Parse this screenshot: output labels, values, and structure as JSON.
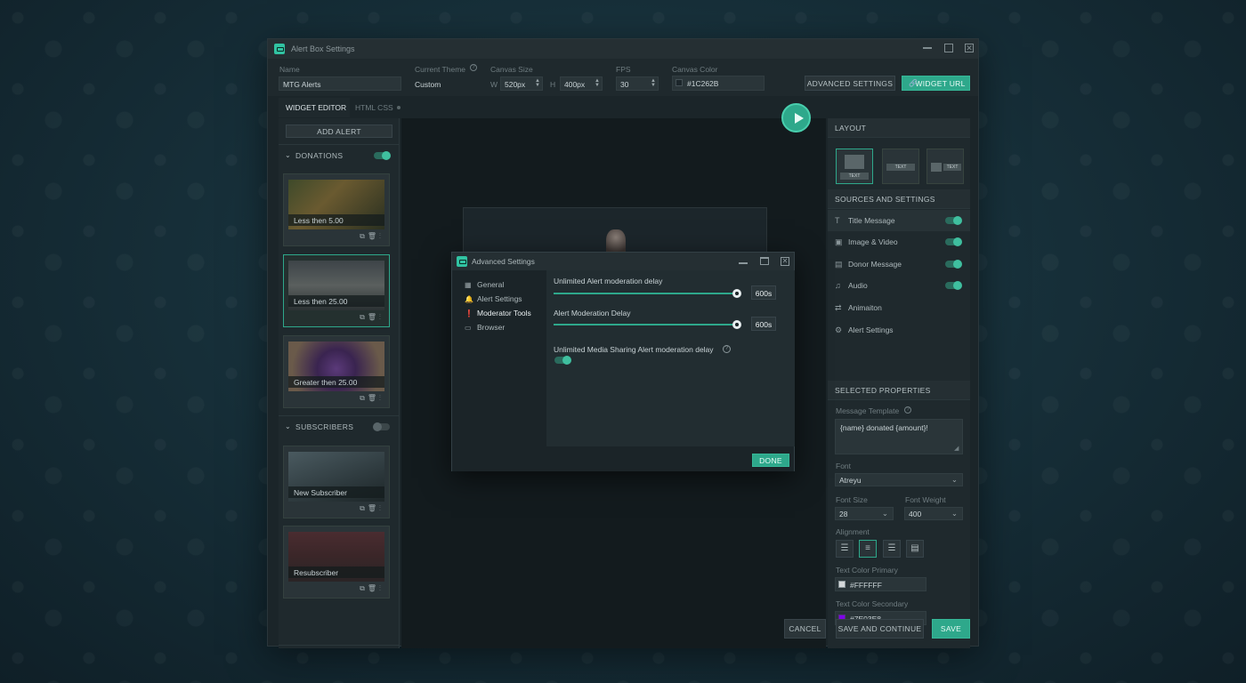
{
  "window": {
    "title": "Alert Box Settings"
  },
  "topbar": {
    "name_label": "Name",
    "name_value": "MTG Alerts",
    "theme_label": "Current Theme",
    "theme_value": "Custom",
    "canvas_size_label": "Canvas Size",
    "w_label": "W",
    "w_value": "520px",
    "h_label": "H",
    "h_value": "400px",
    "fps_label": "FPS",
    "fps_value": "30",
    "canvas_color_label": "Canvas Color",
    "canvas_color_value": "#1C262B",
    "advanced_settings_label": "ADVANCED SETTINGS",
    "widget_url_label": "WIDGET URL"
  },
  "tabs": [
    {
      "label": "WIDGET EDITOR"
    },
    {
      "label": "HTML CSS"
    }
  ],
  "left_panel": {
    "add_alert_label": "ADD ALERT",
    "donations_label": "DONATIONS",
    "donations_enabled": true,
    "donation_cards": [
      {
        "caption": "Less then 5.00"
      },
      {
        "caption": "Less then 25.00"
      },
      {
        "caption": "Greater then 25.00"
      }
    ],
    "subscribers_label": "SUBSCRIBERS",
    "subscribers_enabled": false,
    "subscriber_cards": [
      {
        "caption": "New Subscriber"
      },
      {
        "caption": "Resubscriber"
      }
    ]
  },
  "right_panel": {
    "layout_heading": "LAYOUT",
    "layout_options": [
      {
        "label": "TEXT"
      },
      {
        "label": "TEXT"
      },
      {
        "label": "TEXT"
      }
    ],
    "sources_heading": "SOURCES AND SETTINGS",
    "sources": [
      {
        "label": "Title Message",
        "enabled": true
      },
      {
        "label": "Image & Video",
        "enabled": true
      },
      {
        "label": "Donor Message",
        "enabled": true
      },
      {
        "label": "Audio",
        "enabled": true
      },
      {
        "label": "Animaiton"
      },
      {
        "label": "Alert Settings"
      }
    ],
    "selected_heading": "SELECTED PROPERTIES",
    "message_template_label": "Message Template",
    "message_template_value": "{name} donated {amount}!",
    "font_label": "Font",
    "font_value": "Atreyu",
    "font_size_label": "Font Size",
    "font_size_value": "28",
    "font_weight_label": "Font Weight",
    "font_weight_value": "400",
    "alignment_label": "Alignment",
    "text_color_primary_label": "Text Color Primary",
    "text_color_primary_value": "#FFFFFF",
    "text_color_secondary_label": "Text Color Secondary",
    "text_color_secondary_value": "#7E03E8"
  },
  "footer": {
    "cancel_label": "CANCEL",
    "save_continue_label": "SAVE AND CONTINUE",
    "save_label": "SAVE"
  },
  "modal": {
    "title": "Advanced Settings",
    "nav": [
      {
        "label": "General"
      },
      {
        "label": "Alert Settings"
      },
      {
        "label": "Moderator Tools"
      },
      {
        "label": "Browser"
      }
    ],
    "active_nav": "Moderator Tools",
    "setting1_label": "Unlimited Alert moderation delay",
    "setting1_value": "600s",
    "setting1_level": 1.0,
    "setting2_label": "Alert Moderation Delay",
    "setting2_value": "600s",
    "setting2_level": 1.0,
    "setting3_label": "Unlimited Media Sharing Alert moderation delay",
    "setting3_enabled": true,
    "done_label": "DONE"
  },
  "colors": {
    "accent": "#2EA88B",
    "canvas": "#1C262B",
    "secondary_swatch": "#7E03E8"
  }
}
